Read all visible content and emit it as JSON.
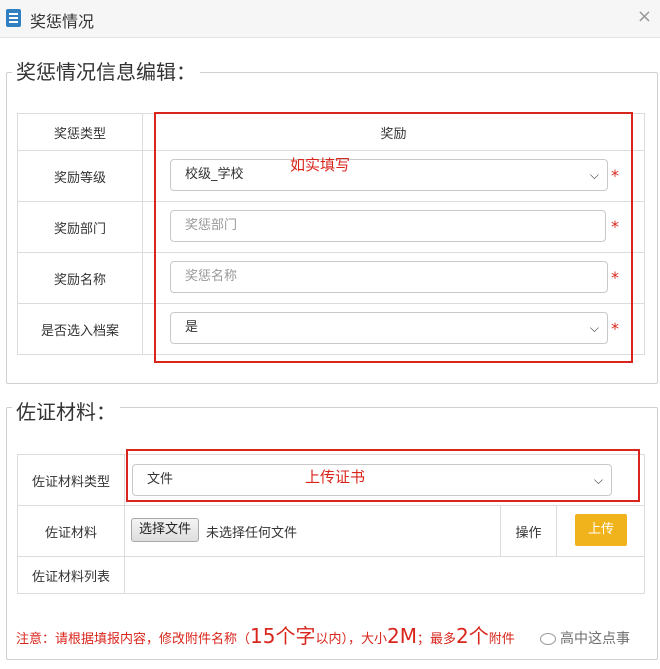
{
  "window": {
    "title": "奖惩情况",
    "close_glyph": "×"
  },
  "section1": {
    "legend": "奖惩情况信息编辑：",
    "type_label": "奖惩类型",
    "type_value": "奖励",
    "level_label": "奖励等级",
    "level_value": "校级_学校",
    "dept_label": "奖励部门",
    "dept_placeholder": "奖惩部门",
    "name_label": "奖励名称",
    "name_placeholder": "奖惩名称",
    "archive_label": "是否选入档案",
    "archive_value": "是",
    "required_mark": "*",
    "annotation": "如实填写"
  },
  "section2": {
    "legend": "佐证材料：",
    "type_label": "佐证材料类型",
    "type_value": "文件",
    "annotation": "上传证书",
    "material_label": "佐证材料",
    "choose_file_button": "选择文件",
    "no_file_text": "未选择任何文件",
    "operation_label": "操作",
    "upload_button": "上传",
    "list_label": "佐证材料列表"
  },
  "note": {
    "part1": "注意：请根据填报内容，修改附件名称（",
    "big1": "15个字",
    "part2": "以内），大小",
    "big2": "2M",
    "part3": "；最多",
    "big3": "2个",
    "part4": "附件"
  },
  "watermark": {
    "text": "高中这点事"
  },
  "colors": {
    "required": "#d9261c",
    "upload": "#f0b31b",
    "annotation": "#d9261c"
  },
  "icons": {
    "app": "form-icon",
    "close": "close-icon",
    "chevron": "chevron-down-icon"
  }
}
